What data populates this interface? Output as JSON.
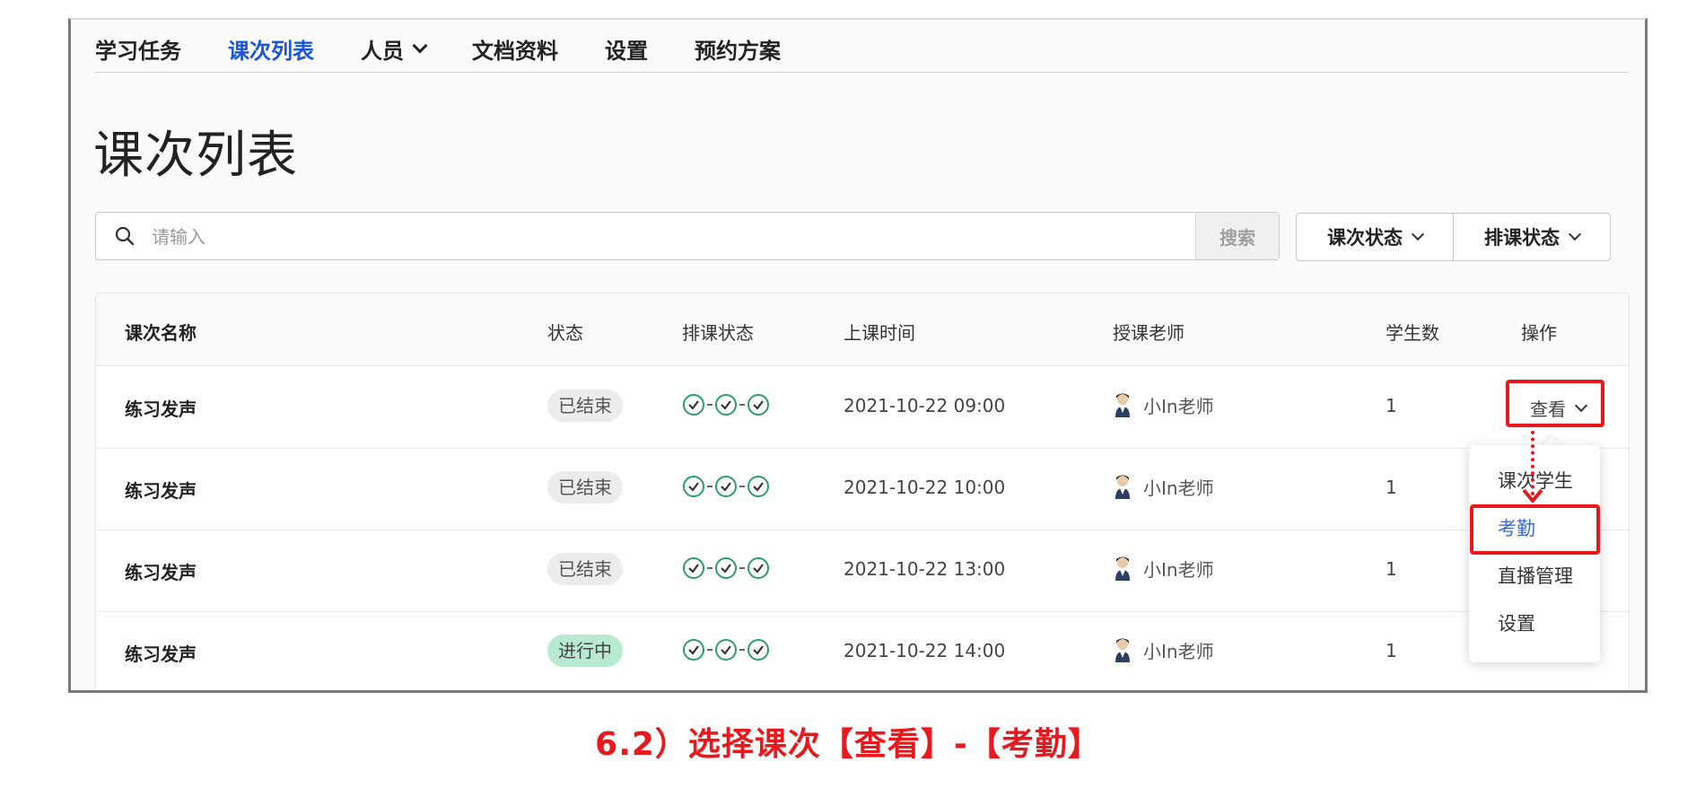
{
  "nav": {
    "items": [
      {
        "label": "学习任务"
      },
      {
        "label": "课次列表",
        "active": true
      },
      {
        "label": "人员",
        "has_dropdown": true
      },
      {
        "label": "文档资料"
      },
      {
        "label": "设置"
      },
      {
        "label": "预约方案"
      }
    ]
  },
  "page": {
    "title": "课次列表"
  },
  "search": {
    "placeholder": "请输入",
    "button_label": "搜索"
  },
  "filters": {
    "lesson_status": "课次状态",
    "schedule_status": "排课状态"
  },
  "table": {
    "headers": {
      "name": "课次名称",
      "status": "状态",
      "schedule": "排课状态",
      "time": "上课时间",
      "teacher": "授课老师",
      "students": "学生数",
      "actions": "操作"
    },
    "rows": [
      {
        "name": "练习发声",
        "status": "已结束",
        "time": "2021-10-22 09:00",
        "teacher": "小In老师",
        "students": "1",
        "action": "查看"
      },
      {
        "name": "练习发声",
        "status": "已结束",
        "time": "2021-10-22 10:00",
        "teacher": "小In老师",
        "students": "1"
      },
      {
        "name": "练习发声",
        "status": "已结束",
        "time": "2021-10-22 13:00",
        "teacher": "小In老师",
        "students": "1"
      },
      {
        "name": "练习发声",
        "status": "进行中",
        "time": "2021-10-22 14:00",
        "teacher": "小In老师",
        "students": "1"
      }
    ]
  },
  "dropdown": {
    "items": [
      {
        "label": "课次学生"
      },
      {
        "label": "考勤",
        "selected": true
      },
      {
        "label": "直播管理"
      },
      {
        "label": "设置"
      }
    ]
  },
  "caption": "6.2）选择课次【查看】-【考勤】",
  "colors": {
    "accent": "#1a56d6",
    "highlight": "#e8181d",
    "ongoing_badge": "#b8ead1",
    "ended_badge": "#ececec"
  }
}
